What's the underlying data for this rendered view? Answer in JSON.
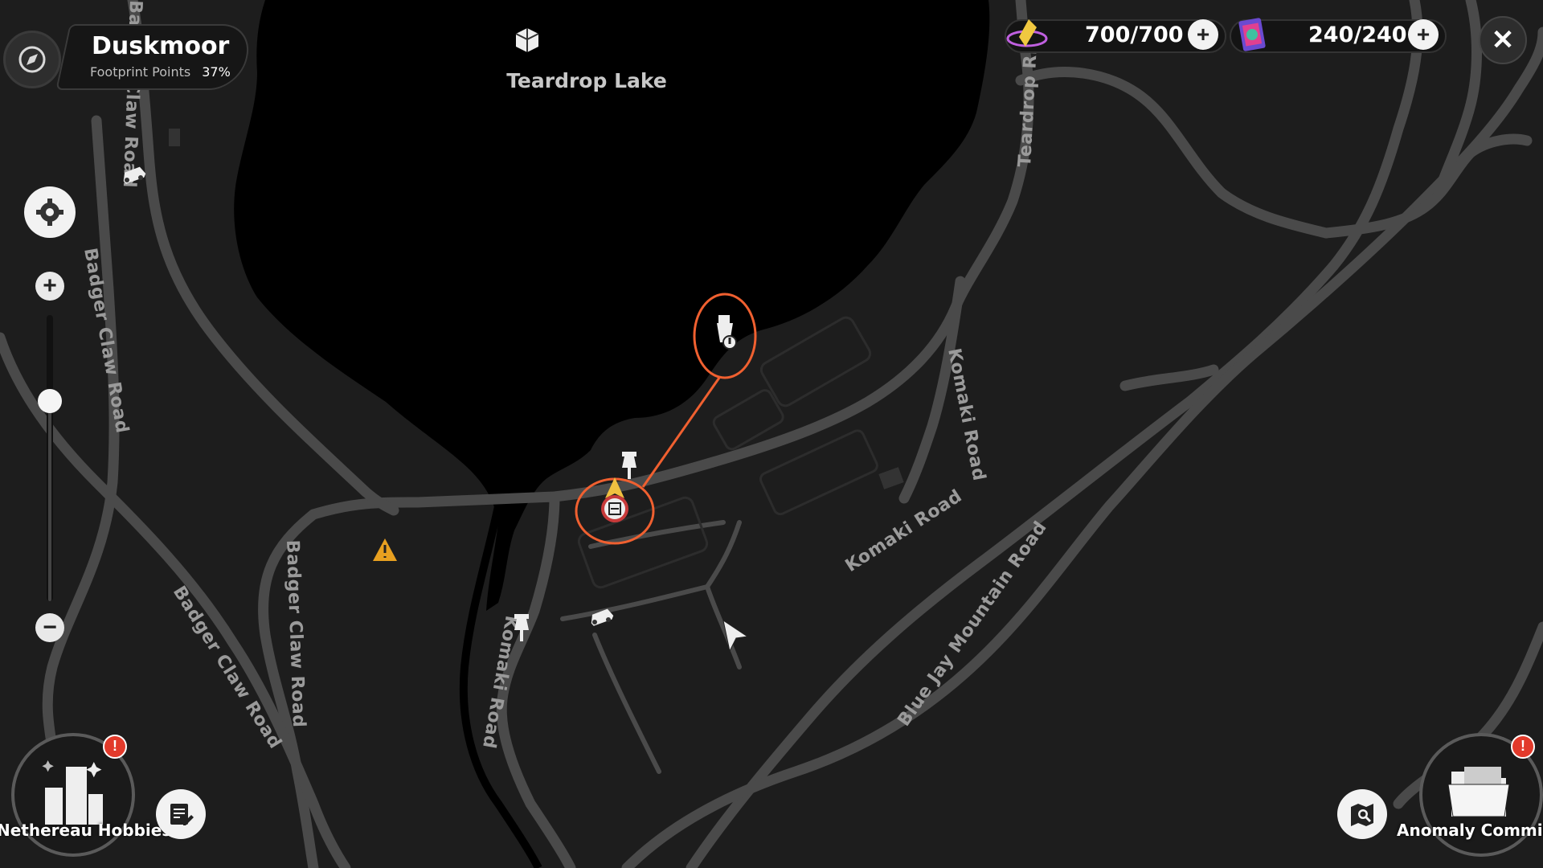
{
  "region": {
    "name": "Duskmoor",
    "footprint_label": "Footprint Points",
    "footprint_pct": "37%"
  },
  "currency": {
    "stamina": {
      "value": "700/700",
      "icon": "stamina-crystal-icon"
    },
    "cards": {
      "value": "240/240",
      "icon": "card-pack-icon"
    }
  },
  "map": {
    "lake_label": "Teardrop Lake",
    "roads": [
      {
        "id": "komaki-road-main",
        "text": "Komaki Road"
      },
      {
        "id": "komaki-road-vertical",
        "text": "Komaki Road"
      },
      {
        "id": "komaki-road-small",
        "text": "Komaki Road"
      },
      {
        "id": "blue-jay-mountain-road",
        "text": "Blue Jay Mountain Road"
      },
      {
        "id": "badger-claw-road-left",
        "text": "Badger Claw Road"
      },
      {
        "id": "badger-claw-road-mid",
        "text": "Badger Claw Road"
      },
      {
        "id": "badger-claw-road-diag",
        "text": "Badger Claw Road"
      },
      {
        "id": "badger-claw-road-top",
        "text": "Badger Claw Road"
      },
      {
        "id": "teardrop-river-road",
        "text": "Teardrop Ri"
      }
    ],
    "markers": [
      "telescope-marker-icon",
      "pin-marker-icon",
      "vendor-stand-marker-icon",
      "player-location-icon",
      "construction-warning-icon",
      "car-marker-icon",
      "fish-marker-icon"
    ]
  },
  "bottom": {
    "hobbies_label": "Nethereau Hobbies",
    "anomaly_label": "Anomaly Commissions",
    "alert": "!"
  },
  "colors": {
    "highlight": "#f06030",
    "road": "#4a4a4a",
    "lake": "#000000",
    "land": "#1d1d1d"
  }
}
